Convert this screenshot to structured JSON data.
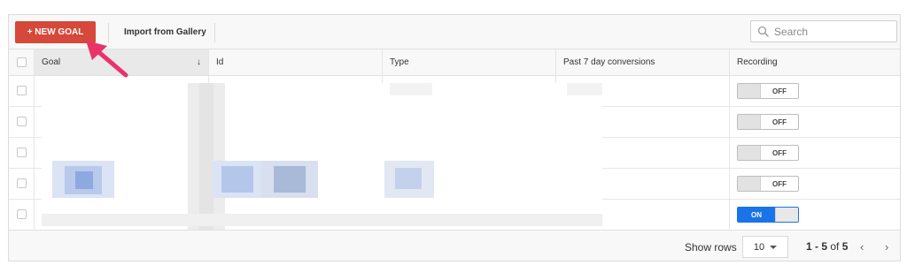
{
  "toolbar": {
    "new_goal_label": "+ NEW GOAL",
    "import_label": "Import from Gallery",
    "search_placeholder": "Search"
  },
  "table": {
    "columns": [
      {
        "label": "Goal",
        "sorted": true,
        "sort_direction": "descending"
      },
      {
        "label": "Id"
      },
      {
        "label": "Type"
      },
      {
        "label": "Past 7 day conversions"
      },
      {
        "label": "Recording"
      }
    ],
    "rows": [
      {
        "recording": "OFF"
      },
      {
        "recording": "OFF"
      },
      {
        "recording": "OFF"
      },
      {
        "recording": "OFF"
      },
      {
        "recording": "ON"
      }
    ]
  },
  "footer": {
    "show_rows_label": "Show rows",
    "rows_value": "10",
    "range_start": "1",
    "range_sep": " - ",
    "range_end": "5",
    "of_label": " of ",
    "total": "5",
    "prev_icon": "‹",
    "next_icon": "›"
  },
  "colors": {
    "primary_button": "#d6483a",
    "toggle_on": "#1a73e8",
    "annotation_arrow": "#e8336b"
  },
  "icons": {
    "search": "search-icon",
    "sort": "arrow-down-icon",
    "caret": "caret-down-icon",
    "prev": "chevron-left-icon",
    "next": "chevron-right-icon"
  }
}
